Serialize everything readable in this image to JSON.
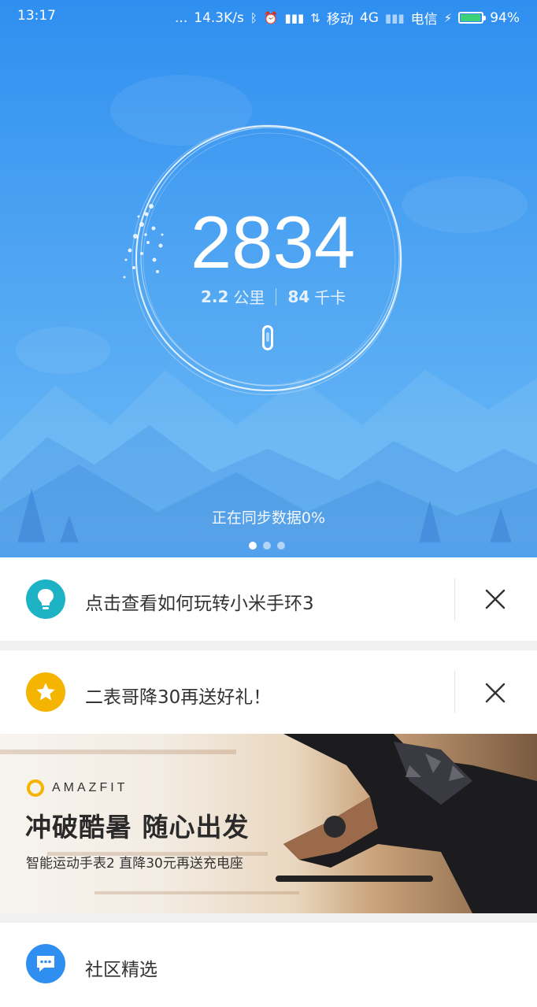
{
  "status_bar": {
    "time": "13:17",
    "dots": "...",
    "speed": "14.3K/s",
    "carrier1": "移动",
    "network": "4G",
    "carrier2": "电信",
    "battery": "94%",
    "battery_level": 0.94
  },
  "hero": {
    "steps": "2834",
    "distance_value": "2.2",
    "distance_unit": "公里",
    "calories_value": "84",
    "calories_unit": "千卡",
    "sync_status": "正在同步数据0%",
    "page_count": 3,
    "active_page": 0
  },
  "tip_card": {
    "text": "点击查看如何玩转小米手环3",
    "icon": "lightbulb-icon",
    "icon_color": "#1db3c5"
  },
  "promo_card": {
    "text": "二表哥降30再送好礼！",
    "icon": "star-icon",
    "icon_color": "#f5b400",
    "banner_brand": "AMAZFIT",
    "banner_title": "冲破酷暑 随心出发",
    "banner_subtitle": "智能运动手表2 直降30元再送充电座"
  },
  "community": {
    "label": "社区精选",
    "icon": "chat-bubble-icon",
    "icon_color": "#2f8ff0"
  },
  "colors": {
    "hero_blue": "#2f8ff0",
    "hero_light": "#6bb9f6"
  }
}
